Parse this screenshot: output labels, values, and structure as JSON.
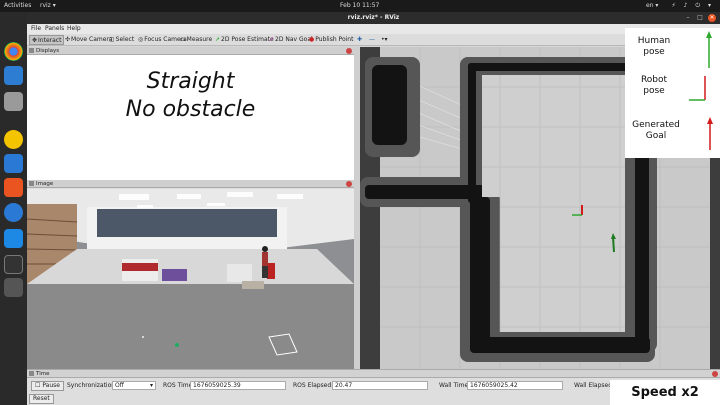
{
  "topbar": {
    "activities": "Activities",
    "app_menu": "rviz ▾",
    "clock": "Feb 10  11:57",
    "lang": "en ▾",
    "tray": "⚡ ♪ ⏻ ▾"
  },
  "window": {
    "title": "rviz.rviz* - RViz"
  },
  "menu": {
    "file": "File",
    "panels": "Panels",
    "help": "Help"
  },
  "toolbar": {
    "interact": "Interact",
    "move_camera": "Move Camera",
    "select": "Select",
    "focus_camera": "Focus Camera",
    "measure": "Measure",
    "pose_estimate": "2D Pose Estimate",
    "nav_goal": "2D Nav Goal",
    "publish_point": "Publish Point"
  },
  "displays": {
    "title": "Displays",
    "line1": "Straight",
    "line2": "No obstacle"
  },
  "image_panel": {
    "title": "Image"
  },
  "legend": {
    "human": "Human\npose",
    "robot": "Robot\npose",
    "goal": "Generated\nGoal",
    "colors": {
      "human": "#2fa82f",
      "robot": "#d21b1b",
      "goal": "#d21b1b"
    }
  },
  "time": {
    "title": "Time",
    "pause": "Pause",
    "sync_label": "Synchronization:",
    "sync_value": "Off",
    "ros_time_label": "ROS Time:",
    "ros_time": "1676059025.39",
    "ros_elapsed_label": "ROS Elapsed:",
    "ros_elapsed": "20.47",
    "wall_time_label": "Wall Time:",
    "wall_time": "1676059025.42",
    "wall_elapsed_label": "Wall Elapsed:",
    "reset": "Reset"
  },
  "speed": "Speed x2"
}
